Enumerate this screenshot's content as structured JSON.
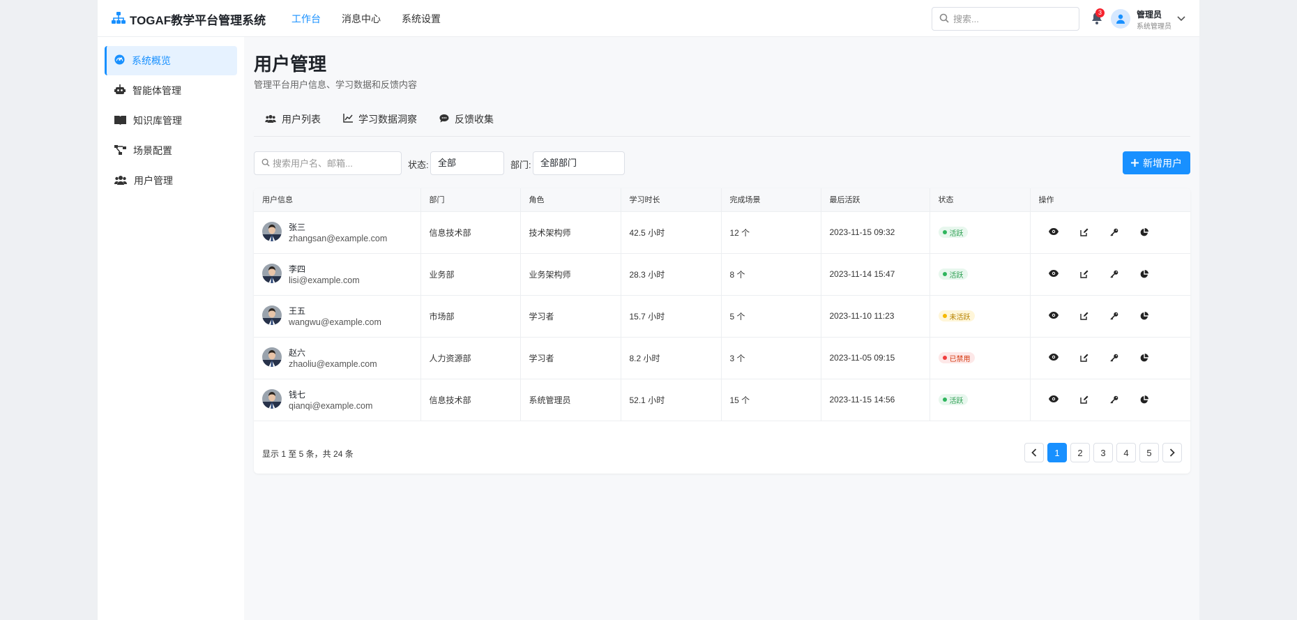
{
  "brand": {
    "title": "TOGAF教学平台管理系统",
    "color": "#1890ff"
  },
  "nav": [
    {
      "label": "工作台",
      "active": true
    },
    {
      "label": "消息中心",
      "active": false
    },
    {
      "label": "系统设置",
      "active": false
    }
  ],
  "search": {
    "placeholder": "搜索..."
  },
  "notifications": {
    "count": "3"
  },
  "user": {
    "name": "管理员",
    "role": "系统管理员"
  },
  "sidebar": {
    "items": [
      {
        "label": "系统概览",
        "icon": "dashboard-icon",
        "active": true
      },
      {
        "label": "智能体管理",
        "icon": "robot-icon",
        "active": false
      },
      {
        "label": "知识库管理",
        "icon": "book-icon",
        "active": false
      },
      {
        "label": "场景配置",
        "icon": "flow-icon",
        "active": false
      },
      {
        "label": "用户管理",
        "icon": "users-icon",
        "active": false
      }
    ]
  },
  "page": {
    "title": "用户管理",
    "subtitle": "管理平台用户信息、学习数据和反馈内容"
  },
  "tabs": [
    {
      "label": "用户列表",
      "icon": "users-icon"
    },
    {
      "label": "学习数据洞察",
      "icon": "line-chart-icon"
    },
    {
      "label": "反馈收集",
      "icon": "comment-icon"
    }
  ],
  "filters": {
    "search_placeholder": "搜索用户名、邮箱...",
    "status_label": "状态:",
    "status_value": "全部",
    "dept_label": "部门:",
    "dept_value": "全部部门"
  },
  "add_button": {
    "label": "新增用户"
  },
  "table": {
    "columns": [
      "用户信息",
      "部门",
      "角色",
      "学习时长",
      "完成场景",
      "最后活跃",
      "状态",
      "操作"
    ],
    "rows": [
      {
        "name": "张三",
        "email": "zhangsan@example.com",
        "dept": "信息技术部",
        "role": "技术架构师",
        "hours": "42.5 小时",
        "scenes": "12 个",
        "last": "2023-11-15 09:32",
        "status": "活跃",
        "status_type": "active"
      },
      {
        "name": "李四",
        "email": "lisi@example.com",
        "dept": "业务部",
        "role": "业务架构师",
        "hours": "28.3 小时",
        "scenes": "8 个",
        "last": "2023-11-14 15:47",
        "status": "活跃",
        "status_type": "active"
      },
      {
        "name": "王五",
        "email": "wangwu@example.com",
        "dept": "市场部",
        "role": "学习者",
        "hours": "15.7 小时",
        "scenes": "5 个",
        "last": "2023-11-10 11:23",
        "status": "未活跃",
        "status_type": "inactive"
      },
      {
        "name": "赵六",
        "email": "zhaoliu@example.com",
        "dept": "人力资源部",
        "role": "学习者",
        "hours": "8.2 小时",
        "scenes": "3 个",
        "last": "2023-11-05 09:15",
        "status": "已禁用",
        "status_type": "disabled"
      },
      {
        "name": "钱七",
        "email": "qianqi@example.com",
        "dept": "信息技术部",
        "role": "系统管理员",
        "hours": "52.1 小时",
        "scenes": "15 个",
        "last": "2023-11-15 14:56",
        "status": "活跃",
        "status_type": "active"
      }
    ]
  },
  "status_colors": {
    "active": {
      "bg": "#e8f7ee",
      "text": "#2a9d4f",
      "dot": "#2fb55d"
    },
    "inactive": {
      "bg": "#fff6d9",
      "text": "#b58100",
      "dot": "#f5b800"
    },
    "disabled": {
      "bg": "#fde8e8",
      "text": "#d4380d",
      "dot": "#f03e3e"
    }
  },
  "footer": {
    "info": "显示 1 至 5 条，共 24 条"
  },
  "pagination": {
    "pages": [
      "1",
      "2",
      "3",
      "4",
      "5"
    ],
    "current": "1"
  }
}
